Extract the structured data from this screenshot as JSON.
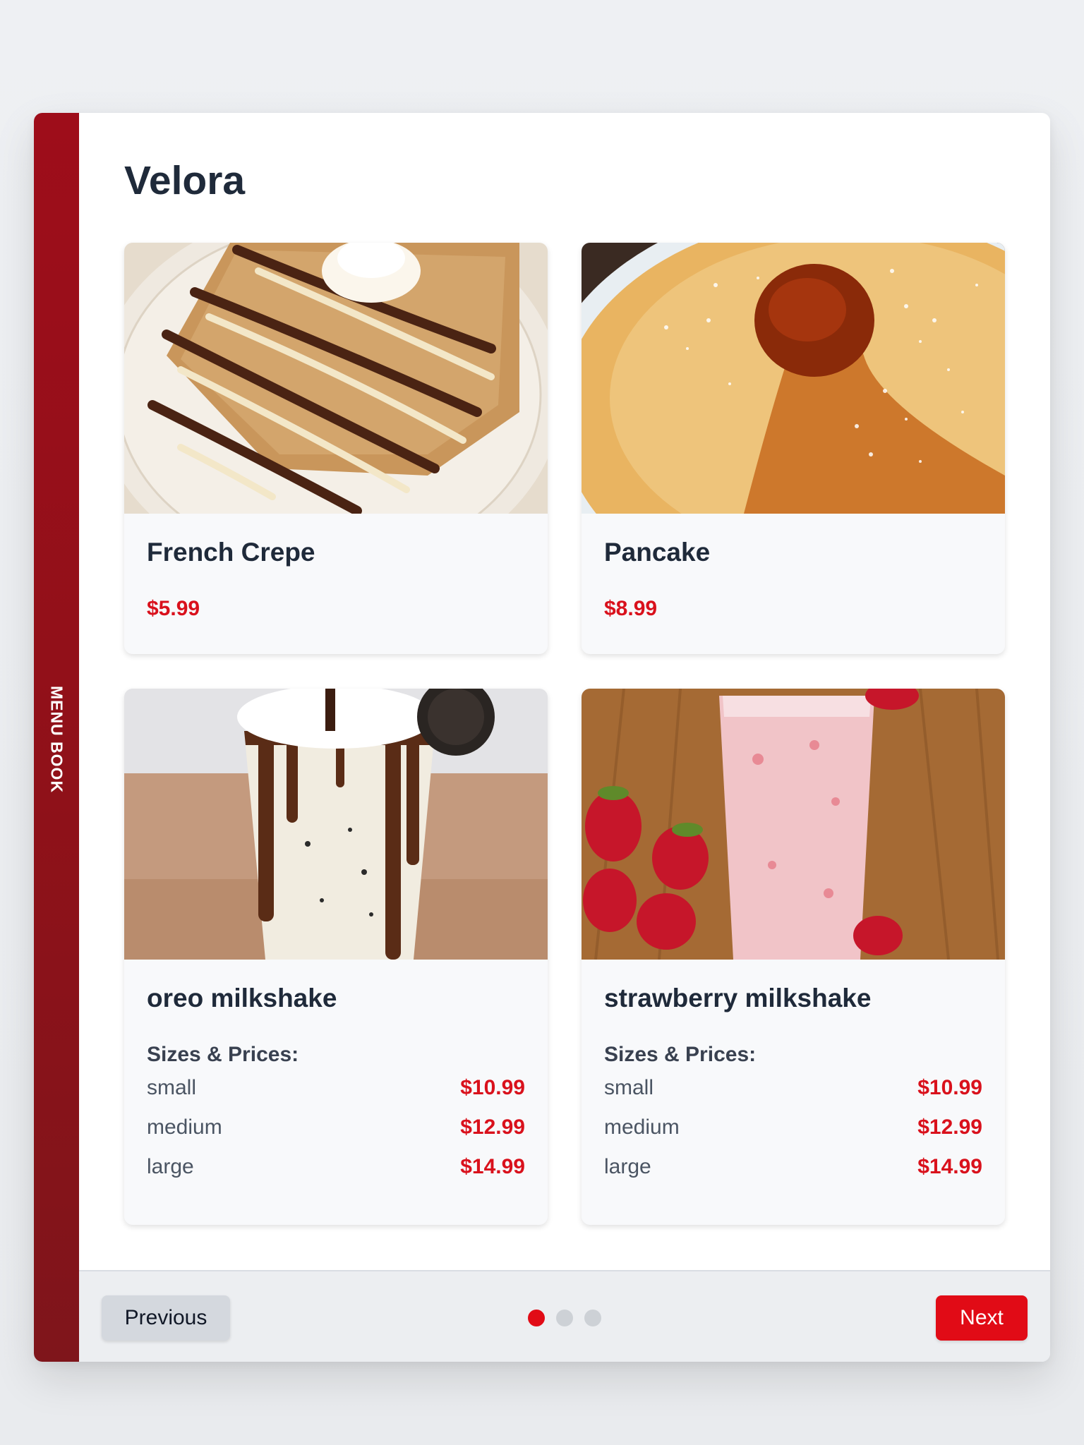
{
  "sidebar": {
    "spine_label": "MENU BOOK"
  },
  "page": {
    "title": "Velora"
  },
  "items": [
    {
      "name": "French Crepe",
      "price": "$5.99",
      "photo": "french-crepe-photo"
    },
    {
      "name": "Pancake",
      "price": "$8.99",
      "photo": "pancake-photo"
    },
    {
      "name": "oreo milkshake",
      "sizes_heading": "Sizes & Prices:",
      "sizes": [
        {
          "size": "small",
          "price": "$10.99"
        },
        {
          "size": "medium",
          "price": "$12.99"
        },
        {
          "size": "large",
          "price": "$14.99"
        }
      ],
      "photo": "oreo-milkshake-photo"
    },
    {
      "name": "strawberry milkshake",
      "sizes_heading": "Sizes & Prices:",
      "sizes": [
        {
          "size": "small",
          "price": "$10.99"
        },
        {
          "size": "medium",
          "price": "$12.99"
        },
        {
          "size": "large",
          "price": "$14.99"
        }
      ],
      "photo": "strawberry-milkshake-photo"
    }
  ],
  "pagination": {
    "previous_label": "Previous",
    "next_label": "Next",
    "page_count": 3,
    "current_page": 1
  },
  "colors": {
    "spine": "#9e0d1a",
    "accent": "#e10b16",
    "price": "#d9111c",
    "title": "#1f2a3a"
  }
}
